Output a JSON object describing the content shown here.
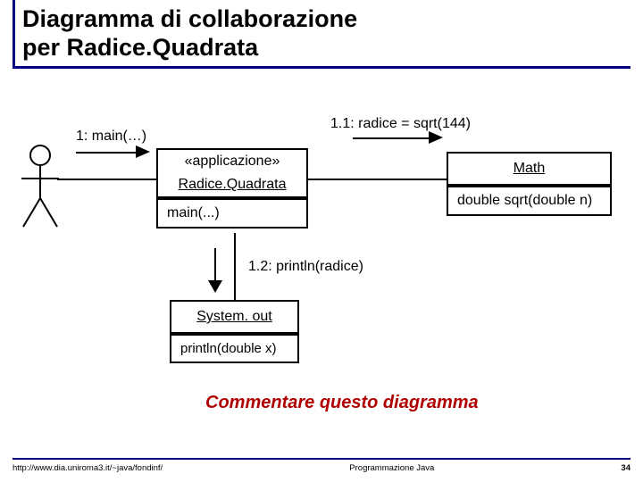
{
  "title_line1": "Diagramma di collaborazione",
  "title_line2": "per Radice.Quadrata",
  "messages": {
    "m1": "1: main(…)",
    "m1_1": "1.1: radice = sqrt(144)",
    "m1_2": "1.2: println(radice)"
  },
  "classes": {
    "app": {
      "stereotype": "«applicazione»",
      "name": "Radice.Quadrata",
      "op": "main(...)"
    },
    "math": {
      "name": "Math",
      "op": "double sqrt(double n)"
    },
    "sysout": {
      "name": "System. out",
      "op": "println(double x)"
    }
  },
  "comment": "Commentare questo diagramma",
  "footer": {
    "left": "http://www.dia.uniroma3.it/~java/fondinf/",
    "center": "Programmazione Java",
    "page": "34"
  }
}
